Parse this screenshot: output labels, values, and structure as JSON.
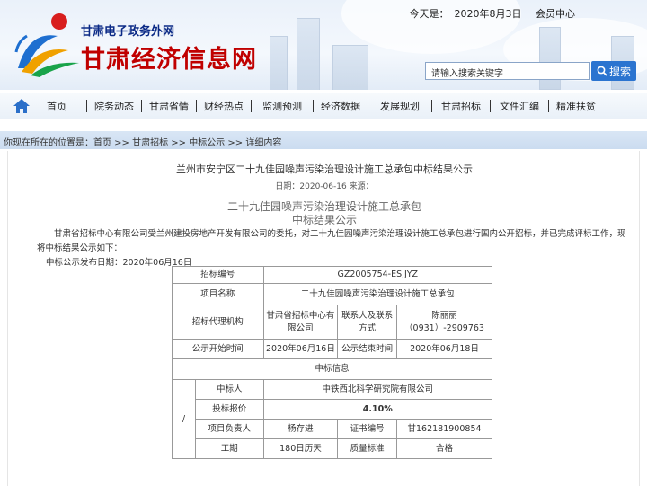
{
  "header": {
    "subtitle": "甘肃电子政务外网",
    "title": "甘肃经济信息网",
    "today_label": "今天是：",
    "date": "2020年8月3日",
    "member_center": "会员中心",
    "search_placeholder": "请输入搜索关键字",
    "search_button": "搜索"
  },
  "nav": {
    "items": [
      "首页",
      "院务动态",
      "甘肃省情",
      "财经热点",
      "监测预测",
      "经济数据",
      "发展规划",
      "甘肃招标",
      "文件汇编",
      "精准扶贫"
    ]
  },
  "breadcrumb": "你现在所在的位置是：首页 >> 甘肃招标 >> 中标公示 >> 详细内容",
  "article": {
    "title": "兰州市安宁区二十九佳园噪声污染治理设计施工总承包中标结果公示",
    "meta": "日期：2020-06-16  来源：",
    "sub_title_1": "二十九佳园噪声污染治理设计施工总承包",
    "sub_title_2": "中标结果公示",
    "paragraph": "甘肃省招标中心有限公司受兰州建投房地产开发有限公司的委托，对二十九佳园噪声污染治理设计施工总承包进行国内公开招标，并已完成评标工作，现将中标结果公示如下：",
    "pub_date": "中标公示发布日期：2020年06月16日"
  },
  "table": {
    "bid_no_label": "招标编号",
    "bid_no": "GZ2005754-ESJJYZ",
    "project_label": "项目名称",
    "project": "二十九佳园噪声污染治理设计施工总承包",
    "agency_label": "招标代理机构",
    "agency": "甘肃省招标中心有限公司",
    "contact_label": "联系人及联系方式",
    "contact": "陈丽丽（0931）-2909763",
    "start_label": "公示开始时间",
    "start": "2020年06月16日",
    "end_label": "公示结束时间",
    "end": "2020年06月18日",
    "winner_section": "中标信息",
    "slash": "/",
    "winner_label": "中标人",
    "winner": "中铁西北科学研究院有限公司",
    "bid_price_label": "投标报价",
    "bid_price": "4.10%",
    "manager_label": "项目负责人",
    "manager": "杨存进",
    "cert_label": "证书编号",
    "cert": "甘162181900854",
    "period_label": "工期",
    "period": "180日历天",
    "quality_label": "质量标准",
    "quality": "合格"
  },
  "colors": {
    "title_red": "#c00000",
    "subtitle_blue": "#0b2a86",
    "search_blue": "#2b74d0",
    "breadcrumb_bg": "#d3e2f3"
  },
  "icons": [
    "logo-icon",
    "home-icon",
    "search-icon"
  ]
}
